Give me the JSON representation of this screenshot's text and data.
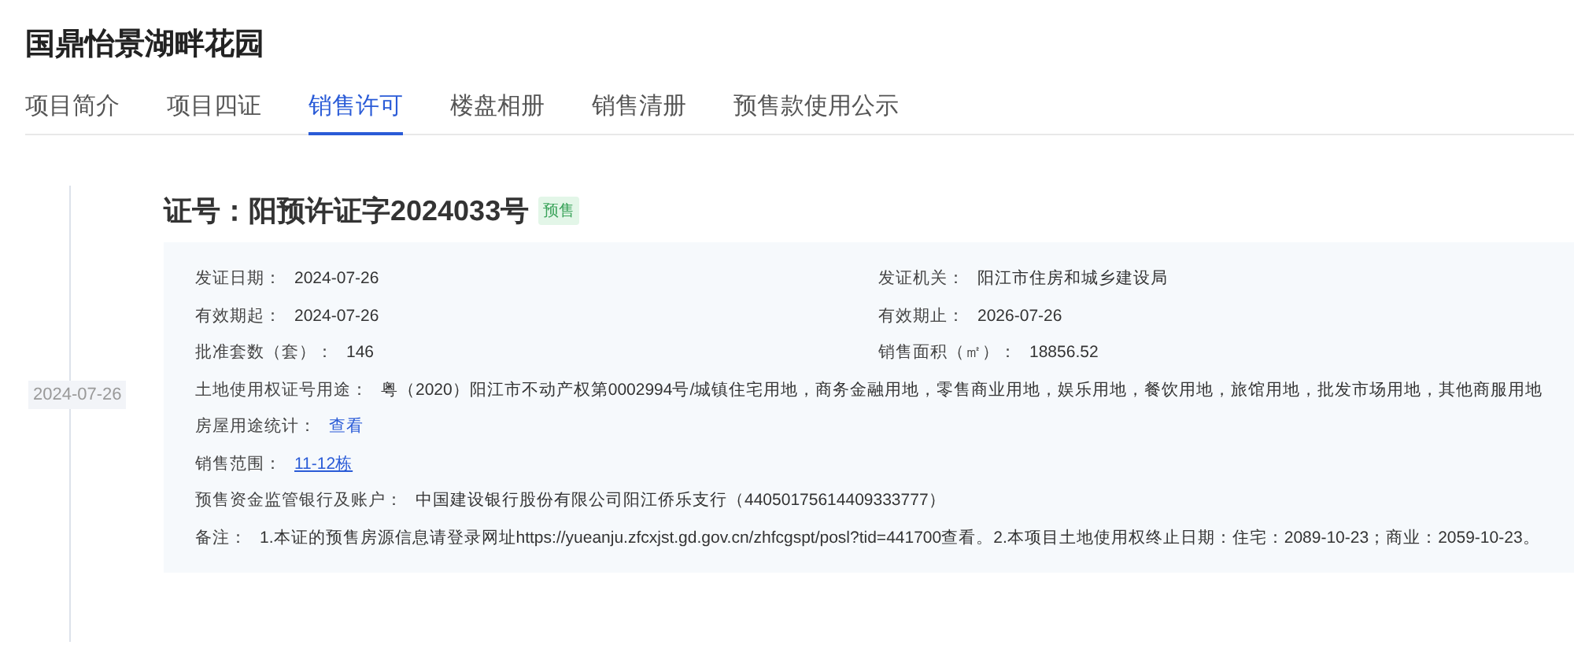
{
  "project": {
    "title": "国鼎怡景湖畔花园"
  },
  "tabs": [
    {
      "label": "项目简介",
      "selected": false
    },
    {
      "label": "项目四证",
      "selected": false
    },
    {
      "label": "销售许可",
      "selected": true
    },
    {
      "label": "楼盘相册",
      "selected": false
    },
    {
      "label": "销售清册",
      "selected": false
    },
    {
      "label": "预售款使用公示",
      "selected": false
    }
  ],
  "timeline": {
    "date": "2024-07-26"
  },
  "permit": {
    "title": "证号：阳预许证字2024033号",
    "tag": "预售",
    "pairs": [
      {
        "left": {
          "label": "发证日期：",
          "value": "2024-07-26"
        },
        "right": {
          "label": "发证机关：",
          "value": "阳江市住房和城乡建设局"
        }
      },
      {
        "left": {
          "label": "有效期起：",
          "value": "2024-07-26"
        },
        "right": {
          "label": "有效期止：",
          "value": "2026-07-26"
        }
      },
      {
        "left": {
          "label": "批准套数（套）：",
          "value": "146"
        },
        "right": {
          "label": "销售面积（㎡）：",
          "value": "18856.52"
        }
      }
    ],
    "rows": [
      {
        "label": "土地使用权证号用途：",
        "value": "粤（2020）阳江市不动产权第0002994号/城镇住宅用地，商务金融用地，零售商业用地，娱乐用地，餐饮用地，旅馆用地，批发市场用地，其他商服用地",
        "kind": "text"
      },
      {
        "label": "房屋用途统计：",
        "value": "查看",
        "kind": "action"
      },
      {
        "label": "销售范围：",
        "value": "11-12栋",
        "kind": "link"
      },
      {
        "label": "预售资金监管银行及账户：",
        "value": "中国建设银行股份有限公司阳江侨乐支行（44050175614409333777）",
        "kind": "text"
      },
      {
        "label": "备注：",
        "value": "1.本证的预售房源信息请登录网址https://yueanju.zfcxjst.gd.gov.cn/zhfcgspt/posl?tid=441700查看。2.本项目土地使用权终止日期：住宅：2089-10-23；商业：2059-10-23。",
        "kind": "text"
      }
    ]
  }
}
